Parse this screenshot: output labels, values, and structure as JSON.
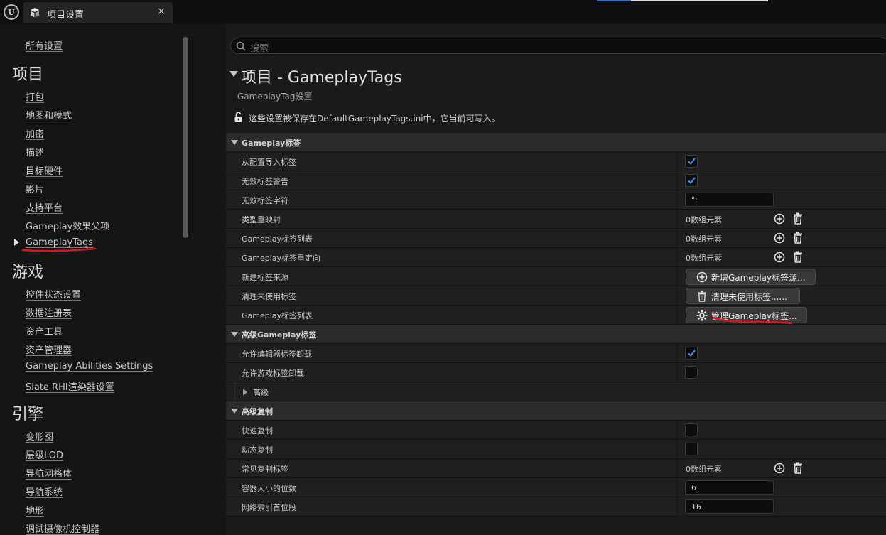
{
  "tab": {
    "title": "项目设置",
    "close": "×"
  },
  "sidebar": {
    "all_settings": "所有设置",
    "sections": [
      {
        "header": "项目",
        "items": [
          "打包",
          "地图和模式",
          "加密",
          "描述",
          "目标硬件",
          "影片",
          "支持平台",
          "Gameplay效果父项",
          "GameplayTags"
        ]
      },
      {
        "header": "游戏",
        "items": [
          "控件状态设置",
          "数据注册表",
          "资产工具",
          "资产管理器",
          "Gameplay Abilities Settings",
          "Slate RHI渲染器设置"
        ]
      },
      {
        "header": "引擎",
        "items": [
          "变形图",
          "层级LOD",
          "导航网格体",
          "导航系统",
          "地形",
          "调试摄像机控制器"
        ]
      }
    ],
    "selected": "GameplayTags"
  },
  "main": {
    "search_placeholder": "搜索",
    "title": "项目 - GameplayTags",
    "subtitle": "GameplayTag设置",
    "storage_note": "这些设置被保存在DefaultGameplayTags.ini中，它当前可写入。",
    "rows": [
      {
        "kind": "category",
        "name": "Gameplay标签"
      },
      {
        "kind": "checkbox",
        "name": "从配置导入标签",
        "checked": true
      },
      {
        "kind": "checkbox",
        "name": "无效标签警告",
        "checked": true
      },
      {
        "kind": "text",
        "name": "无效标签字符",
        "value": "\";"
      },
      {
        "kind": "array",
        "name": "类型重映射",
        "value": "0数组元素"
      },
      {
        "kind": "array",
        "name": "Gameplay标签列表",
        "value": "0数组元素"
      },
      {
        "kind": "array",
        "name": "Gameplay标签重定向",
        "value": "0数组元素"
      },
      {
        "kind": "button",
        "name": "新建标签来源",
        "button": "新增Gameplay标签源...",
        "icon": "plus-icon",
        "width": 183
      },
      {
        "kind": "button",
        "name": "清理未使用标签",
        "button": "清理未使用标签......",
        "icon": "trash-icon",
        "width": 161
      },
      {
        "kind": "button",
        "name": "Gameplay标签列表",
        "button": "管理Gameplay标签...",
        "icon": "gear-icon",
        "width": 171
      },
      {
        "kind": "category",
        "name": "高级Gameplay标签"
      },
      {
        "kind": "checkbox",
        "name": "允许编辑器标签卸载",
        "checked": true
      },
      {
        "kind": "checkbox",
        "name": "允许游戏标签卸载",
        "checked": false
      },
      {
        "kind": "subgroup",
        "name": "高级"
      },
      {
        "kind": "category",
        "name": "高级复制"
      },
      {
        "kind": "checkbox",
        "name": "快速复制",
        "checked": false
      },
      {
        "kind": "checkbox",
        "name": "动态复制",
        "checked": false
      },
      {
        "kind": "array",
        "name": "常见复制标签",
        "value": "0数组元素"
      },
      {
        "kind": "text",
        "name": "容器大小的位数",
        "value": "6"
      },
      {
        "kind": "text",
        "name": "网络索引首位段",
        "value": "16"
      }
    ]
  },
  "colors": {
    "accent": "#2a72d4",
    "checkmark": "#3a8ef6",
    "annotation": "#d8161c"
  }
}
